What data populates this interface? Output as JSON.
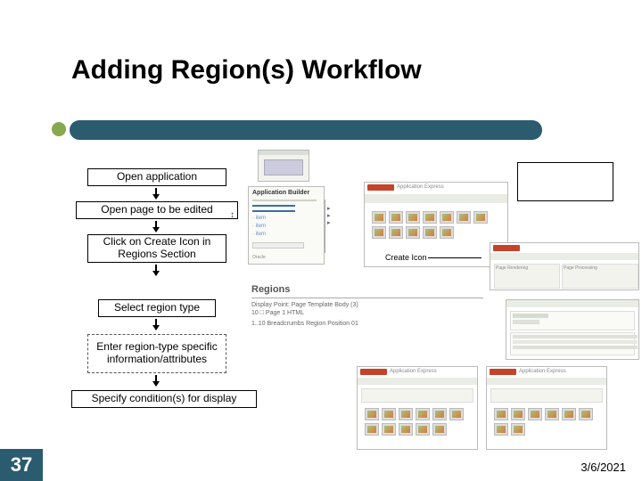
{
  "title": "Adding Region(s) Workflow",
  "steps": {
    "s1": "Open application",
    "s2": "Open page to be edited",
    "s3": "Click on Create Icon in Regions Section",
    "s4": "Select region type",
    "s5": "Enter region-type specific information/attributes",
    "s6": "Specify condition(s) for display"
  },
  "callout": {
    "create_icon": "Create Icon"
  },
  "regions_panel": {
    "header": "Regions",
    "line1": "Display Point: Page Template Body (3)",
    "line2": "10   □ Page 1   HTML",
    "line3": "1..10   Breadcrumbs Region Position 01"
  },
  "screenshot_labels": {
    "appbuilder": "Application Builder",
    "appexpress": "Application Express"
  },
  "slide_number": "37",
  "date": "3/6/2021"
}
